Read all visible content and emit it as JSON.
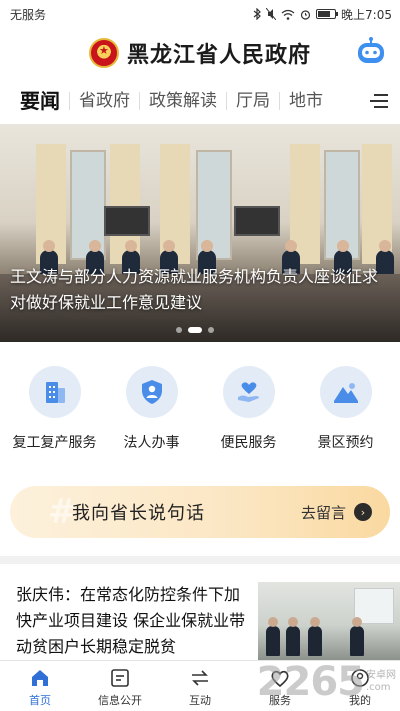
{
  "status_bar": {
    "carrier": "无服务",
    "time": "晚上7:05",
    "battery_level": 0.75,
    "icons": [
      "bluetooth-icon",
      "mute-icon",
      "wifi-icon",
      "alarm-icon",
      "battery-icon"
    ]
  },
  "header": {
    "title": "黑龙江省人民政府",
    "emblem_icon": "national-emblem-icon",
    "assistant_icon": "robot-assistant-icon"
  },
  "tabs": [
    {
      "label": "要闻",
      "active": true
    },
    {
      "label": "省政府",
      "active": false
    },
    {
      "label": "政策解读",
      "active": false
    },
    {
      "label": "厅局",
      "active": false
    },
    {
      "label": "地市",
      "active": false
    }
  ],
  "hero": {
    "caption": "王文涛与部分人力资源就业服务机构负责人座谈征求对做好保就业工作意见建议",
    "slide_count": 3,
    "active_slide": 1
  },
  "services": [
    {
      "label": "复工复产服务",
      "icon": "building-icon"
    },
    {
      "label": "法人办事",
      "icon": "person-shield-icon"
    },
    {
      "label": "便民服务",
      "icon": "heart-hand-icon"
    },
    {
      "label": "景区预约",
      "icon": "mountain-icon"
    }
  ],
  "governor_banner": {
    "title": "我向省长说句话",
    "action": "去留言"
  },
  "news": [
    {
      "title": "张庆伟：在常态化防控条件下加快产业项目建设 保企业保就业带动贫困户长期稳定脱贫"
    }
  ],
  "bottom_nav": [
    {
      "label": "首页",
      "icon": "home-icon",
      "active": true
    },
    {
      "label": "信息公开",
      "icon": "info-doc-icon",
      "active": false
    },
    {
      "label": "互动",
      "icon": "interact-icon",
      "active": false
    },
    {
      "label": "服务",
      "icon": "heart-icon",
      "active": false
    },
    {
      "label": "我的",
      "icon": "user-icon",
      "active": false
    }
  ],
  "watermark": {
    "number": "2265",
    "brand": "安卓网",
    "domain": ".com"
  },
  "colors": {
    "accent": "#2f6fd6",
    "service_icon_bg": "#e3ebf6",
    "banner_gradient": "#fbe6c2"
  }
}
